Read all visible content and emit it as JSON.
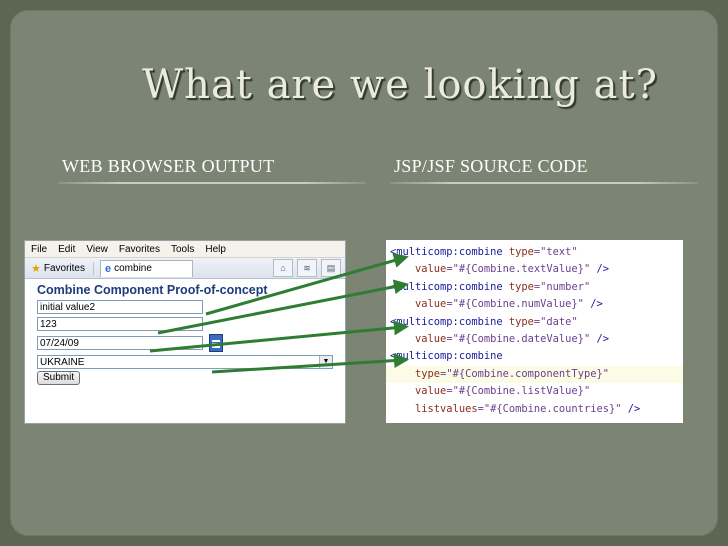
{
  "title": "What are we looking at?",
  "headings": {
    "left": "WEB BROWSER OUTPUT",
    "right": "JSP/JSF SOURCE CODE"
  },
  "browser": {
    "menu": [
      "File",
      "Edit",
      "View",
      "Favorites",
      "Tools",
      "Help"
    ],
    "favorites_label": "Favorites",
    "tab_label": "combine",
    "page_title": "Combine Component Proof-of-concept",
    "text_value": "initial value2",
    "number_value": "123",
    "date_value": "07/24/09",
    "select_value": "UKRAINE",
    "submit_label": "Submit"
  },
  "code": {
    "line1_tag": "<multicomp:combine",
    "line1_attr": "type",
    "line1_val": "=\"text\"",
    "line2_attr": "value",
    "line2_val": "=\"#{Combine.textValue}\"",
    "line2_end": " />",
    "line3_tag": "<multicomp:combine",
    "line3_attr": "type",
    "line3_val": "=\"number\"",
    "line4_attr": "value",
    "line4_val": "=\"#{Combine.numValue}\"",
    "line4_end": " />",
    "line5_tag": "<multicomp:combine",
    "line5_attr": "type",
    "line5_val": "=\"date\"",
    "line6_attr": "value",
    "line6_val": "=\"#{Combine.dateValue}\"",
    "line6_end": " />",
    "line7_tag": "<multicomp:combine",
    "line8_attr": "type",
    "line8_val": "=\"#{Combine.componentType}\"",
    "line9_attr": "value",
    "line9_val": "=\"#{Combine.listValue}\"",
    "line10_attr": "listvalues",
    "line10_val": "=\"#{Combine.countries}\"",
    "line10_end": " />"
  },
  "colors": {
    "background": "#5d6653",
    "slide": "#7c8473",
    "arrow": "#2e7d32"
  },
  "icons": [
    "star-icon",
    "ie-icon",
    "home-icon",
    "feed-icon",
    "print-icon",
    "calendar-icon",
    "dropdown-arrow-icon"
  ]
}
